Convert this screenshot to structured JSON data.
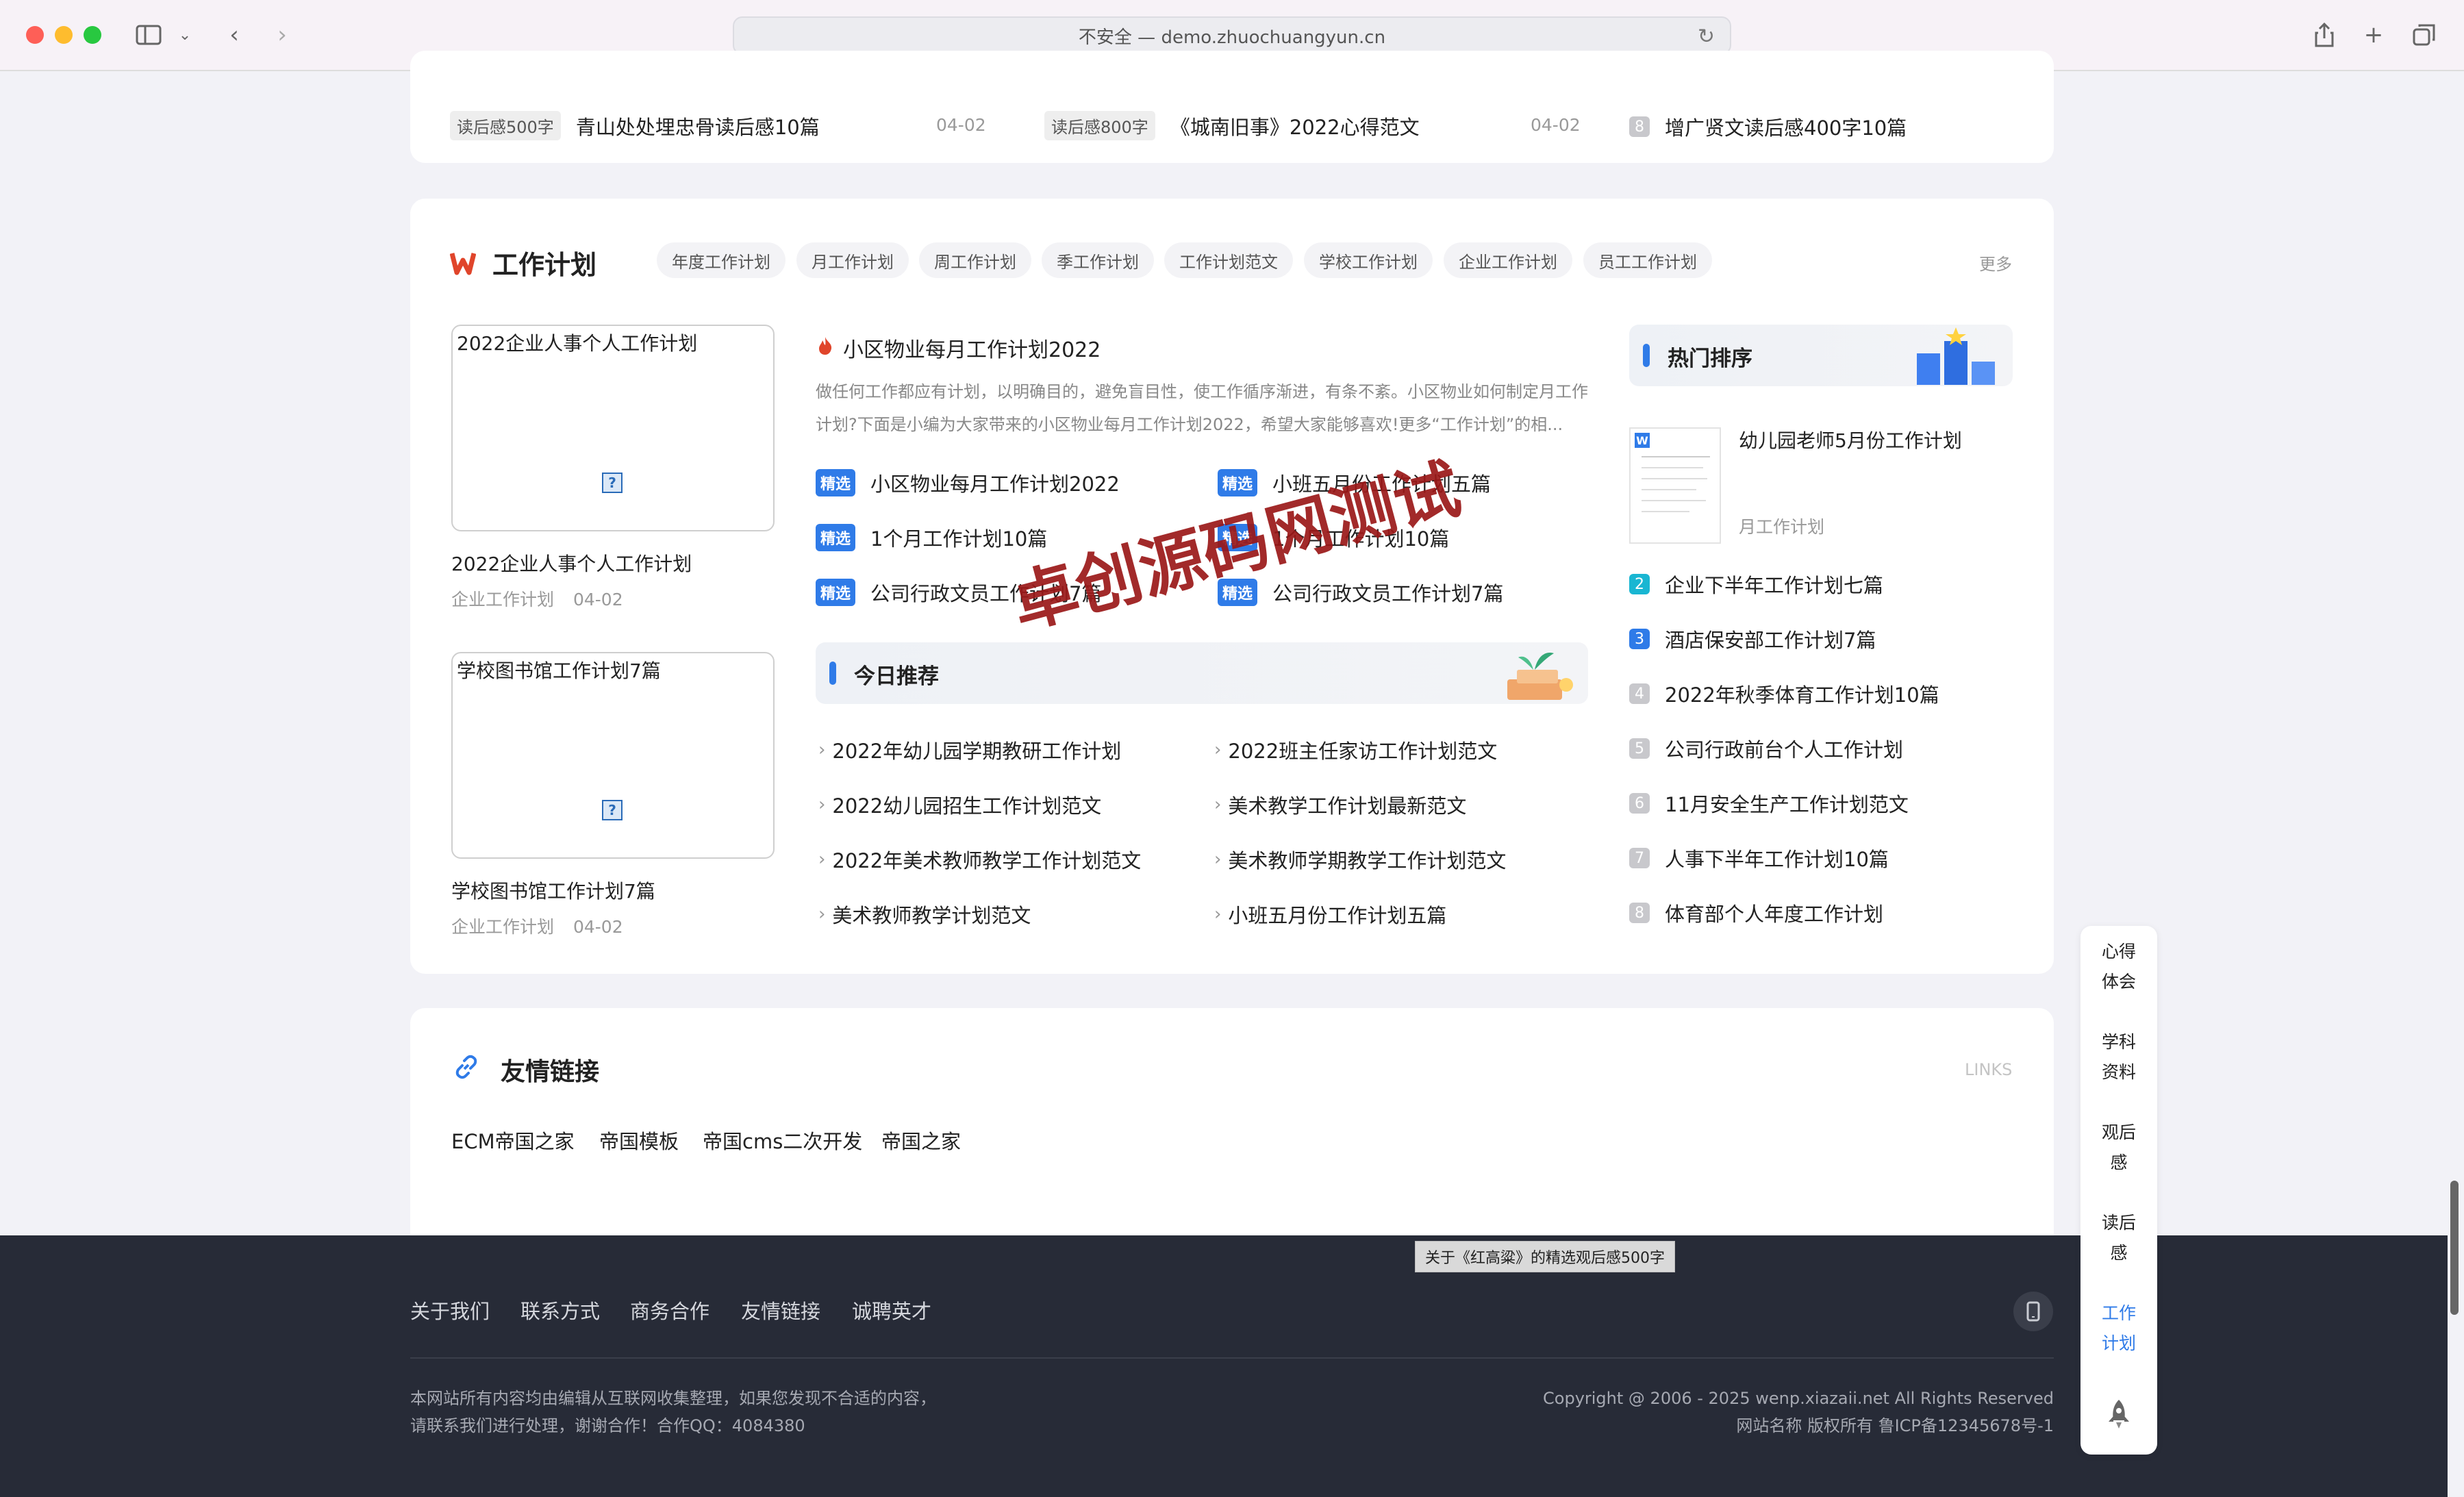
{
  "browser": {
    "url": "不安全 — demo.zhuochuangyun.cn"
  },
  "top_strip": {
    "items": [
      {
        "tag": "读后感500字",
        "title": "青山处处埋忠骨读后感10篇",
        "date": "04-02"
      },
      {
        "tag": "读后感800字",
        "title": "《城南旧事》2022心得范文",
        "date": "04-02"
      },
      {
        "rank": "8",
        "title": "增广贤文读后感400字10篇"
      }
    ]
  },
  "work_plan": {
    "title": "工作计划",
    "logo": "W",
    "tabs": [
      "年度工作计划",
      "月工作计划",
      "周工作计划",
      "季工作计划",
      "工作计划范文",
      "学校工作计划",
      "企业工作计划",
      "员工工作计划"
    ],
    "more": "更多",
    "thumbs": [
      {
        "img_alt": "2022企业人事个人工作计划",
        "caption": "2022企业人事个人工作计划",
        "category": "企业工作计划",
        "date": "04-02"
      },
      {
        "img_alt": "学校图书馆工作计划7篇",
        "caption": "学校图书馆工作计划7篇",
        "category": "企业工作计划",
        "date": "04-02"
      }
    ],
    "featured": {
      "title": "小区物业每月工作计划2022",
      "summary_line1": "做任何工作都应有计划，以明确目的，避免盲目性，使工作循序渐进，有条不紊。小区物业如何制定月工作",
      "summary_line2": "计划?下面是小编为大家带来的小区物业每月工作计划2022，希望大家能够喜欢!更多“工作计划”的相..."
    },
    "badge": "精选",
    "picks": [
      "小区物业每月工作计划2022",
      "小班五月份工作计划五篇",
      "1个月工作计划10篇",
      "1个月工作计划10篇",
      "公司行政文员工作计划7篇",
      "公司行政文员工作计划7篇"
    ],
    "today": {
      "title": "今日推荐",
      "items": [
        "2022年幼儿园学期教研工作计划",
        "2022班主任家访工作计划范文",
        "2022幼儿园招生工作计划范文",
        "美术教学工作计划最新范文",
        "2022年美术教师教学工作计划范文",
        "美术教师学期教学工作计划范文",
        "美术教师教学计划范文",
        "小班五月份工作计划五篇"
      ]
    },
    "hot": {
      "title": "热门排序",
      "top": {
        "title": "幼儿园老师5月份工作计划",
        "category": "月工作计划"
      },
      "items": [
        {
          "rank": "2",
          "title": "企业下半年工作计划七篇"
        },
        {
          "rank": "3",
          "title": "酒店保安部工作计划7篇"
        },
        {
          "rank": "4",
          "title": "2022年秋季体育工作计划10篇"
        },
        {
          "rank": "5",
          "title": "公司行政前台个人工作计划"
        },
        {
          "rank": "6",
          "title": "11月安全生产工作计划范文"
        },
        {
          "rank": "7",
          "title": "人事下半年工作计划10篇"
        },
        {
          "rank": "8",
          "title": "体育部个人年度工作计划"
        }
      ]
    }
  },
  "links": {
    "title": "友情链接",
    "tag": "LINKS",
    "items": [
      "ECM帝国之家",
      "帝国模板",
      "帝国cms二次开发",
      "帝国之家"
    ]
  },
  "watermark": "卓创源码网测试",
  "tooltip": "关于《红高粱》的精选观后感500字",
  "footer": {
    "nav": [
      "关于我们",
      "联系方式",
      "商务合作",
      "友情链接",
      "诚聘英才"
    ],
    "left_line1": "本网站所有内容均由编辑从互联网收集整理，如果您发现不合适的内容，",
    "left_line2": "请联系我们进行处理，谢谢合作！合作QQ：4084380",
    "right_line1": "Copyright @ 2006 - 2025 wenp.xiazaii.net All Rights Reserved",
    "right_line2": "网站名称  版权所有   鲁ICP备12345678号-1"
  },
  "float_nav": [
    {
      "line1": "心得",
      "line2": "体会"
    },
    {
      "line1": "学科",
      "line2": "资料"
    },
    {
      "line1": "观后",
      "line2": "感"
    },
    {
      "line1": "读后",
      "line2": "感"
    },
    {
      "line1": "工作",
      "line2": "计划"
    }
  ],
  "colors": {
    "accent": "#2f7be8",
    "brand_red": "#e0452b",
    "footer_bg": "#272b37"
  }
}
